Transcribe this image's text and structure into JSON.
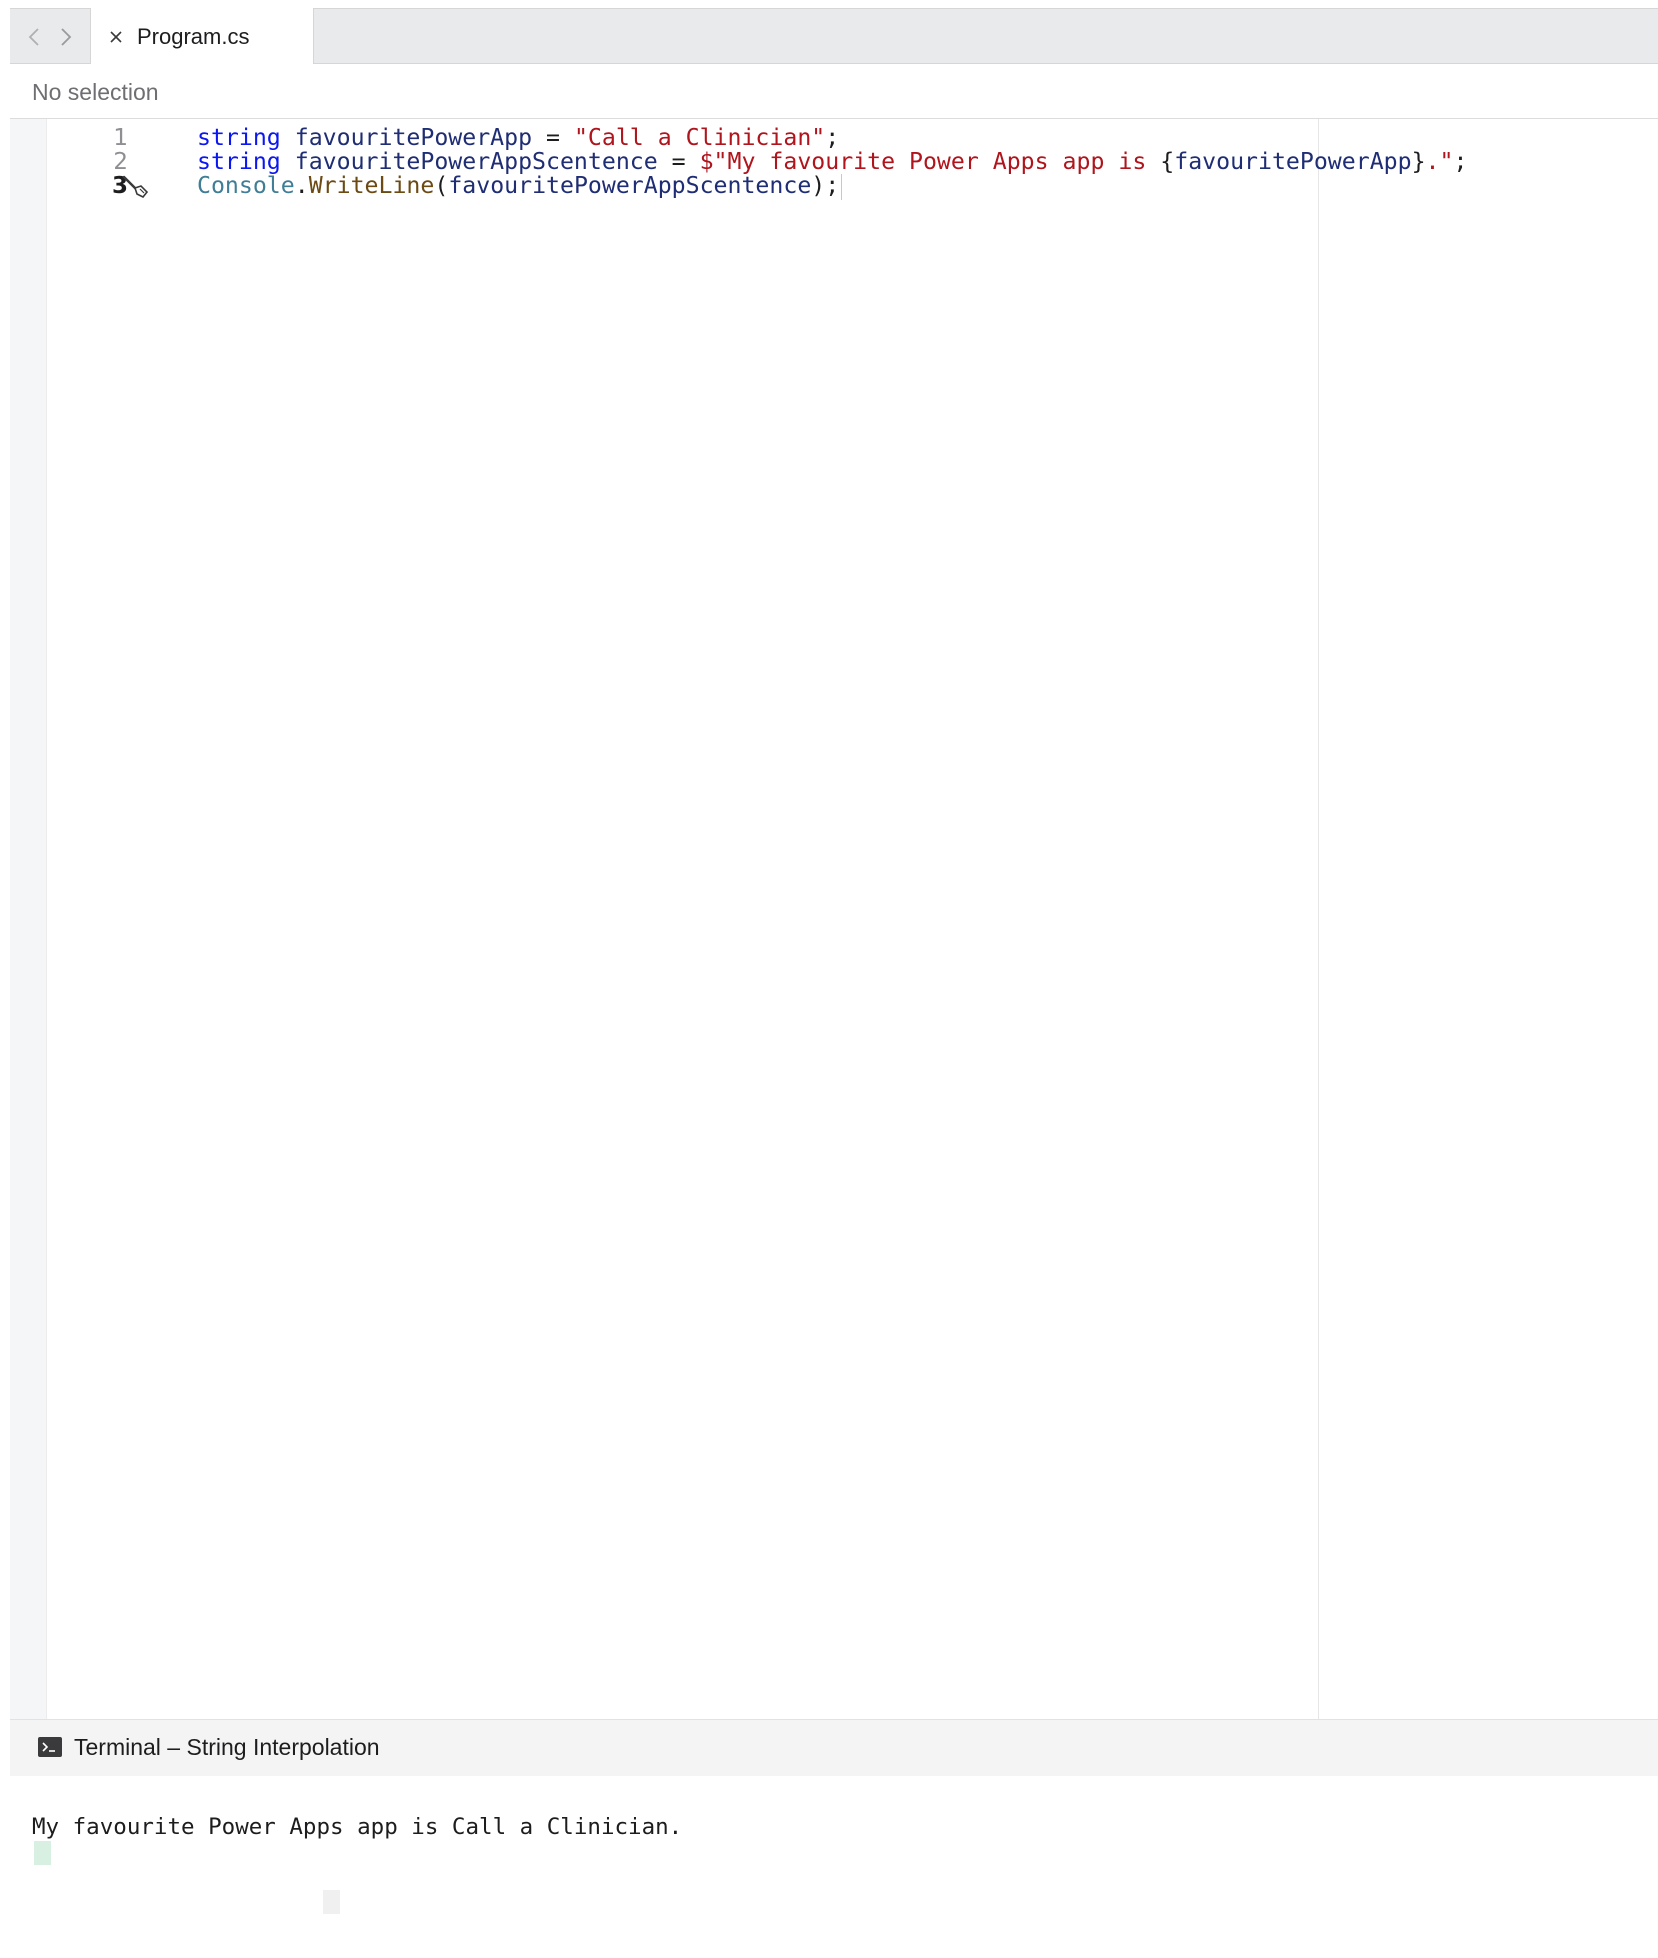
{
  "tab": {
    "label": "Program.cs"
  },
  "breadcrumb": {
    "text": "No selection"
  },
  "editor": {
    "lines": [
      {
        "number": "1",
        "tokens": [
          {
            "t": "string",
            "c": "kw"
          },
          {
            "t": " ",
            "c": "op"
          },
          {
            "t": "favouritePowerApp",
            "c": "ident"
          },
          {
            "t": " = ",
            "c": "op"
          },
          {
            "t": "\"Call a Clinician\"",
            "c": "str"
          },
          {
            "t": ";",
            "c": "op"
          }
        ]
      },
      {
        "number": "2",
        "tokens": [
          {
            "t": "string",
            "c": "kw"
          },
          {
            "t": " ",
            "c": "op"
          },
          {
            "t": "favouritePowerAppScentence",
            "c": "ident"
          },
          {
            "t": " = ",
            "c": "op"
          },
          {
            "t": "$\"My favourite Power Apps app is ",
            "c": "str"
          },
          {
            "t": "{",
            "c": "op"
          },
          {
            "t": "favouritePowerApp",
            "c": "ident"
          },
          {
            "t": "}",
            "c": "op"
          },
          {
            "t": ".\"",
            "c": "str"
          },
          {
            "t": ";",
            "c": "op"
          }
        ]
      },
      {
        "number": "3",
        "current": true,
        "tokens": [
          {
            "t": "Console",
            "c": "cls"
          },
          {
            "t": ".",
            "c": "op"
          },
          {
            "t": "WriteLine",
            "c": "method"
          },
          {
            "t": "(",
            "c": "op"
          },
          {
            "t": "favouritePowerAppScentence",
            "c": "ident"
          },
          {
            "t": ");",
            "c": "op"
          }
        ]
      }
    ]
  },
  "terminal": {
    "title": "Terminal – String Interpolation",
    "output": "My favourite Power Apps app is Call a Clinician."
  },
  "colors": {
    "keyword": "#0b17f2",
    "identifier": "#1f2d74",
    "string": "#b0141c",
    "class": "#3f7e96",
    "method": "#6c4a14"
  },
  "icons": [
    "chevron-left-icon",
    "chevron-right-icon",
    "close-icon",
    "fix-it-icon",
    "terminal-icon"
  ]
}
